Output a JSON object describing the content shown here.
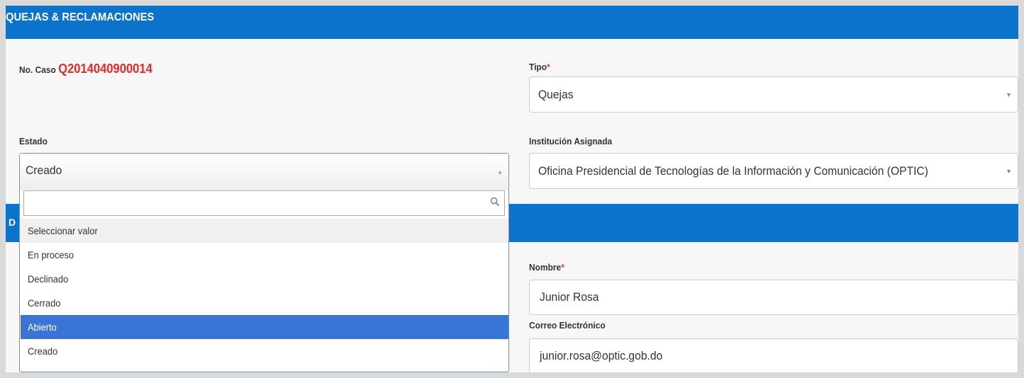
{
  "section": {
    "title": "QUEJAS & RECLAMACIONES",
    "second_bar_fragment": "D"
  },
  "case": {
    "label": "No. Caso",
    "number": "Q2014040900014"
  },
  "tipo": {
    "label": "Tipo",
    "required_mark": "*",
    "value": "Quejas"
  },
  "estado": {
    "label": "Estado",
    "value": "Creado",
    "search_placeholder": "",
    "options": [
      "Seleccionar valor",
      "En proceso",
      "Declinado",
      "Cerrado",
      "Abierto",
      "Creado"
    ],
    "highlighted_option": "Abierto"
  },
  "institucion": {
    "label": "Institución Asignada",
    "value": "Oficina Presidencial de Tecnologías de la Información y Comunicación  (OPTIC)"
  },
  "nombre": {
    "label": "Nombre",
    "required_mark": "*",
    "value": "Junior Rosa"
  },
  "correo": {
    "label": "Correo Electrónico",
    "value": "junior.rosa@optic.gob.do"
  },
  "colors": {
    "section_bar": "#0b73cc",
    "case_number": "#e52a2a",
    "selected_option": "#3875d7"
  }
}
